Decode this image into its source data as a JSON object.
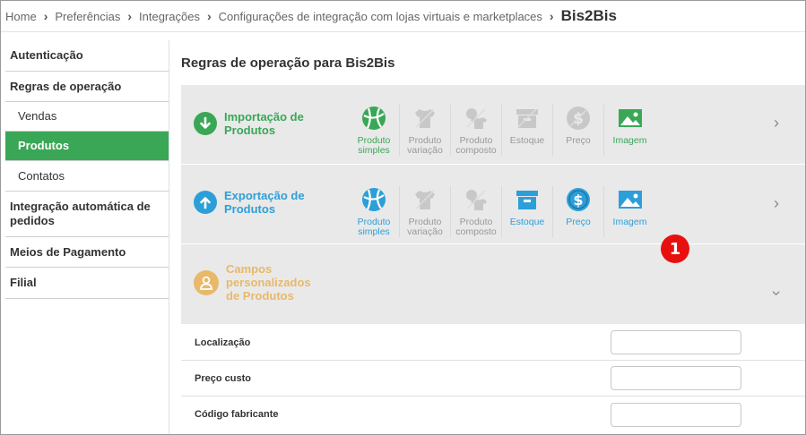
{
  "breadcrumb": {
    "items": [
      "Home",
      "Preferências",
      "Integrações",
      "Configurações de integração com lojas virtuais e marketplaces"
    ],
    "current": "Bis2Bis"
  },
  "sidebar": {
    "items": [
      {
        "label": "Autenticação"
      },
      {
        "label": "Regras de operação"
      },
      {
        "label": "Vendas"
      },
      {
        "label": "Produtos"
      },
      {
        "label": "Contatos"
      },
      {
        "label": "Integração automática de pedidos"
      },
      {
        "label": "Meios de Pagamento"
      },
      {
        "label": "Filial"
      }
    ]
  },
  "main": {
    "title": "Regras de operação para Bis2Bis",
    "import_panel": {
      "title": "Importação de Produtos",
      "color": "#3aa757",
      "tiles": [
        {
          "label": "Produto simples",
          "icon": "ball-icon",
          "enabled": true
        },
        {
          "label": "Produto variação",
          "icon": "shirt-icon",
          "enabled": false
        },
        {
          "label": "Produto composto",
          "icon": "composite-icon",
          "enabled": false
        },
        {
          "label": "Estoque",
          "icon": "box-icon",
          "enabled": false
        },
        {
          "label": "Preço",
          "icon": "dollar-icon",
          "enabled": false
        },
        {
          "label": "Imagem",
          "icon": "image-icon",
          "enabled": true
        }
      ]
    },
    "export_panel": {
      "title": "Exportação de Produtos",
      "color": "#2d9fd8",
      "tiles": [
        {
          "label": "Produto simples",
          "icon": "ball-icon",
          "enabled": true
        },
        {
          "label": "Produto variação",
          "icon": "shirt-icon",
          "enabled": false
        },
        {
          "label": "Produto composto",
          "icon": "composite-icon",
          "enabled": false
        },
        {
          "label": "Estoque",
          "icon": "box-icon",
          "enabled": true
        },
        {
          "label": "Preço",
          "icon": "dollar-icon",
          "enabled": true
        },
        {
          "label": "Imagem",
          "icon": "image-icon",
          "enabled": true
        }
      ]
    },
    "custom_panel": {
      "title": "Campos personalizados de Produtos",
      "color": "#e8b96a",
      "badge": "1"
    },
    "fields": [
      {
        "label": "Localização",
        "value": ""
      },
      {
        "label": "Preço custo",
        "value": ""
      },
      {
        "label": "Código fabricante",
        "value": ""
      }
    ]
  }
}
